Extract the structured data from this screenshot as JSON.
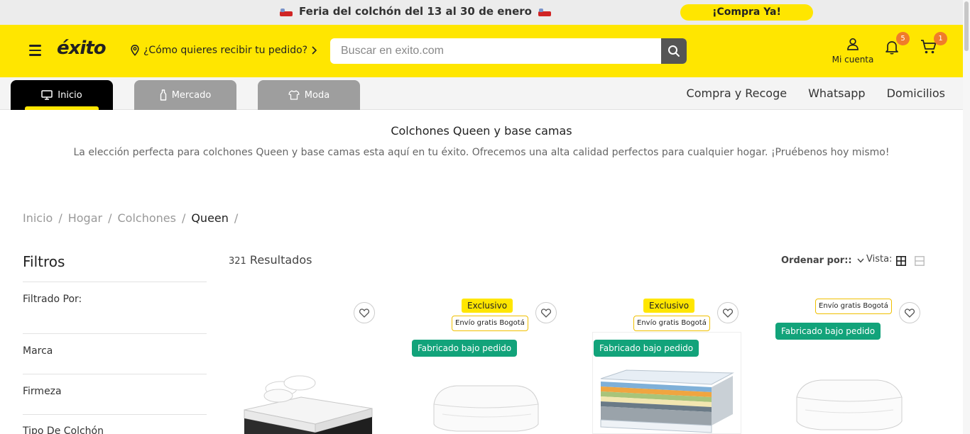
{
  "promo": {
    "text": "Feria del colchón del 13 al 30 de enero",
    "cta": "¡Compra Ya!"
  },
  "header": {
    "logo": "éxito",
    "location": "¿Cómo quieres recibir tu pedido?",
    "search_placeholder": "Buscar en exito.com",
    "account_label": "Mi cuenta",
    "notifications_count": "5",
    "cart_count": "1"
  },
  "nav": {
    "tabs": [
      {
        "label": "Inicio"
      },
      {
        "label": "Mercado"
      },
      {
        "label": "Moda"
      }
    ],
    "links": [
      "Compra y Recoge",
      "Whatsapp",
      "Domicilios"
    ]
  },
  "intro": {
    "title": "Colchones Queen y base camas",
    "description": "La elección perfecta para colchones Queen y base camas esta aquí en tu éxito. Ofrecemos una alta calidad perfectos para cualquier hogar. ¡Pruébenos hoy mismo!"
  },
  "breadcrumb": [
    "Inicio",
    "Hogar",
    "Colchones",
    "Queen"
  ],
  "filters": {
    "title": "Filtros",
    "items": [
      "Filtrado Por:",
      "Marca",
      "Firmeza",
      "Tipo De Colchón"
    ]
  },
  "results": {
    "count": "321",
    "label": "Resultados"
  },
  "sort_label": "Ordenar por::",
  "view_label": "Vista:",
  "products": [
    {
      "tags": []
    },
    {
      "tags": [
        "Exclusivo",
        "Envío gratis Bogotá",
        "Fabricado bajo pedido"
      ]
    },
    {
      "tags": [
        "Exclusivo",
        "Envío gratis Bogotá",
        "Fabricado bajo pedido"
      ]
    },
    {
      "tags": [
        "Envío gratis Bogotá",
        "Fabricado bajo pedido"
      ]
    }
  ],
  "colors": {
    "brand_yellow": "#ffe600",
    "fabricado_green": "#12a37a",
    "badge_orange": "#f07c2a"
  }
}
